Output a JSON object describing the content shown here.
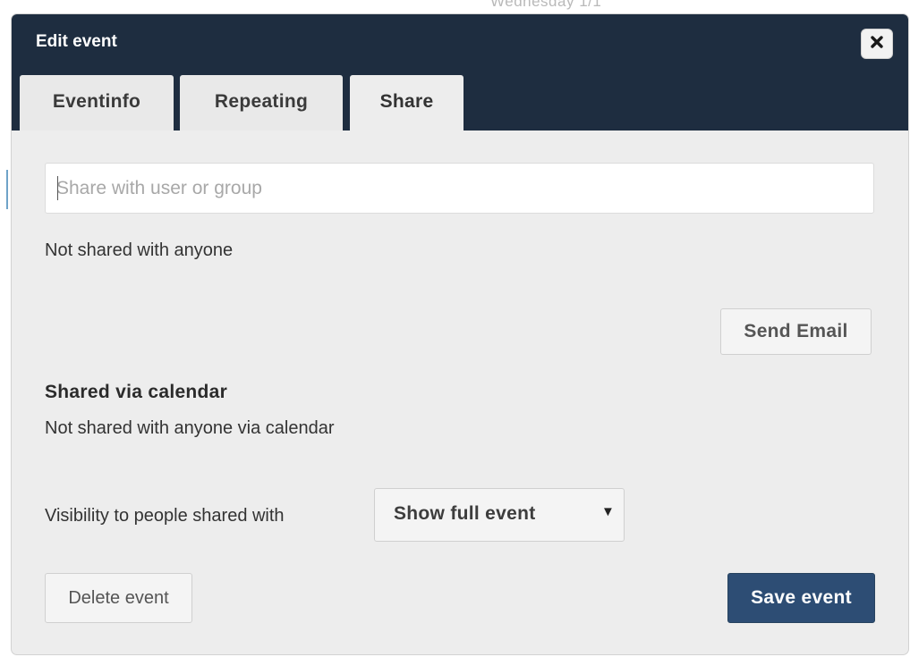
{
  "background": {
    "date_heading": "Wednesday 1/1"
  },
  "dialog": {
    "title": "Edit event",
    "close_icon": "close-icon",
    "tabs": [
      {
        "label": "Eventinfo",
        "active": false
      },
      {
        "label": "Repeating",
        "active": false
      },
      {
        "label": "Share",
        "active": true
      }
    ],
    "share": {
      "input_placeholder": "Share with user or group",
      "input_value": "",
      "status": "Not shared with anyone",
      "send_email_label": "Send Email",
      "calendar_heading": "Shared via calendar",
      "calendar_status": "Not shared with anyone via calendar",
      "visibility_label": "Visibility to people shared with",
      "visibility_selected": "Show full event",
      "dropdown_icon": "caret-down-icon"
    },
    "footer": {
      "delete_label": "Delete event",
      "save_label": "Save event"
    }
  },
  "colors": {
    "header_bg": "#1e2d40",
    "dialog_bg": "#ededed",
    "primary_button": "#2d4d74"
  }
}
